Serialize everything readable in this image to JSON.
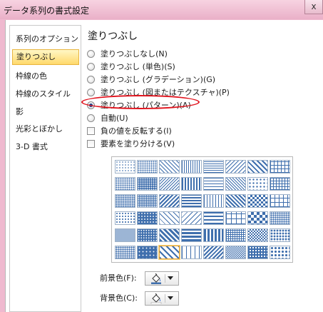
{
  "window": {
    "title": "データ系列の書式設定",
    "close_label": "x"
  },
  "sidebar": {
    "items": [
      {
        "label": "系列のオプション",
        "active": false
      },
      {
        "label": "塗りつぶし",
        "active": true
      },
      {
        "label": "枠線の色",
        "active": false
      },
      {
        "label": "枠線のスタイル",
        "active": false
      },
      {
        "label": "影",
        "active": false
      },
      {
        "label": "光彩とぼかし",
        "active": false
      },
      {
        "label": "3-D 書式",
        "active": false
      }
    ]
  },
  "panel": {
    "heading": "塗りつぶし",
    "options": [
      {
        "label": "塗りつぶしなし(N)",
        "checked": false
      },
      {
        "label": "塗りつぶし (単色)(S)",
        "checked": false
      },
      {
        "label": "塗りつぶし (グラデーション)(G)",
        "checked": false
      },
      {
        "label": "塗りつぶし (図またはテクスチャ)(P)",
        "checked": false
      },
      {
        "label": "塗りつぶし (パターン)(A)",
        "checked": true
      },
      {
        "label": "自動(U)",
        "checked": false
      }
    ],
    "checkboxes": [
      {
        "label": "負の値を反転する(I)",
        "checked": false
      },
      {
        "label": "要素を塗り分ける(V)",
        "checked": false
      }
    ],
    "pattern_color": "#3f6fad",
    "selected_pattern": "row 6, column 3",
    "foreground_label": "前景色(F):",
    "background_label": "背景色(C):"
  }
}
